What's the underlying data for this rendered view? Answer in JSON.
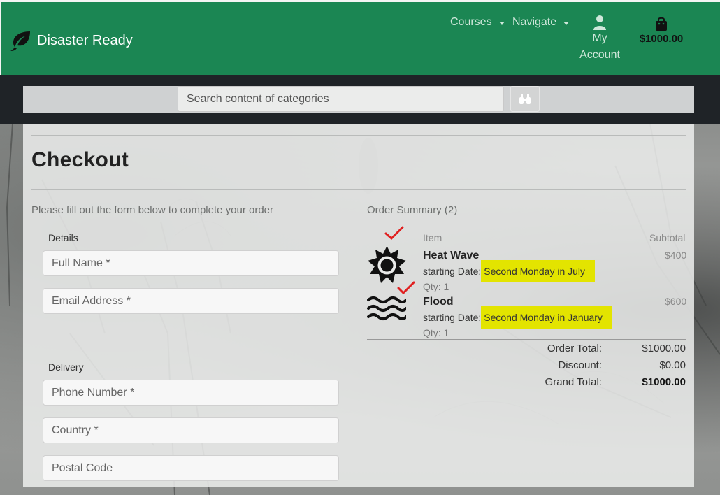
{
  "brand": {
    "name": "Disaster Ready",
    "color": "#1b8653"
  },
  "nav": {
    "courses": "Courses",
    "navigate": "Navigate",
    "account_line1": "My",
    "account_line2": "Account",
    "cart_total": "$1000.00"
  },
  "search": {
    "placeholder": "Search content of categories"
  },
  "page": {
    "title": "Checkout",
    "form_intro": "Please fill out the form below to complete your order",
    "details_label": "Details",
    "delivery_label": "Delivery",
    "fields": {
      "full_name": "Full Name *",
      "email": "Email Address *",
      "phone": "Phone Number *",
      "country": "Country *",
      "postal": "Postal Code"
    }
  },
  "summary": {
    "heading": "Order Summary (2)",
    "col_item": "Item",
    "col_subtotal": "Subtotal",
    "items": [
      {
        "name": "Heat Wave",
        "date_label": "starting Date:",
        "date": "Second Monday in July",
        "qty": "Qty: 1",
        "price": "$400",
        "icon": "sun-icon"
      },
      {
        "name": "Flood",
        "date_label": "starting Date:",
        "date": "Second Monday in January",
        "qty": "Qty: 1",
        "price": "$600",
        "icon": "waves-icon"
      }
    ],
    "order_total_label": "Order Total:",
    "order_total": "$1000.00",
    "discount_label": "Discount:",
    "discount": "$0.00",
    "grand_total_label": "Grand Total:",
    "grand_total": "$1000.00"
  },
  "highlight_color": "#e3e400",
  "check_color": "#e02020"
}
